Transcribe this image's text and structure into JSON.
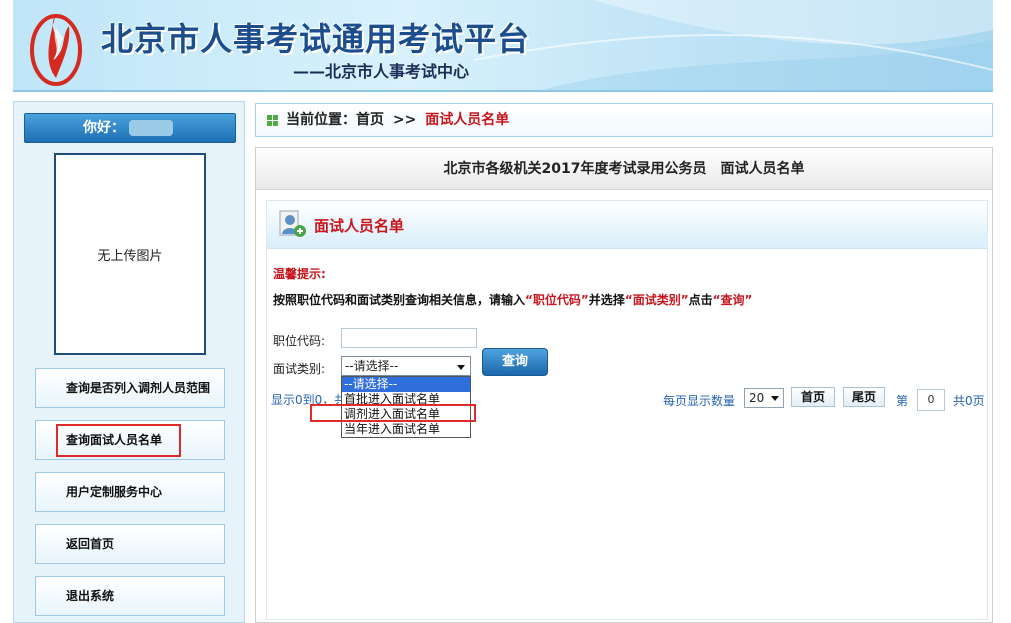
{
  "header": {
    "title": "北京市人事考试通用考试平台",
    "subtitle": "——北京市人事考试中心"
  },
  "sidebar": {
    "greeting": "你好：",
    "photo_text": "无上传图片",
    "items": [
      {
        "label": "查询是否列入调剂人员范围"
      },
      {
        "label": "查询面试人员名单"
      },
      {
        "label": "用户定制服务中心"
      },
      {
        "label": "返回首页"
      },
      {
        "label": "退出系统"
      }
    ]
  },
  "breadcrumb": {
    "prefix": "当前位置：首页",
    "sep": ">>",
    "current": "面试人员名单"
  },
  "main": {
    "heading": "北京市各级机关2017年度考试录用公务员　面试人员名单",
    "section_title": "面试人员名单",
    "tip_title": "温馨提示:",
    "tip_text": {
      "p1": "按照职位代码和面试类别查询相关信息，请输入",
      "k1": "“职位代码”",
      "p2": "并选择",
      "k2": "“面试类别”",
      "p3": "点击",
      "k3": "“查询”"
    },
    "form": {
      "position_code_label": "职位代码:",
      "position_code_value": "",
      "category_label": "面试类别:",
      "category_selected": "--请选择--",
      "category_options": [
        "--请选择--",
        "首批进入面试名单",
        "调剂进入面试名单",
        "当年进入面试名单"
      ],
      "query_label": "查询"
    },
    "results_info": "显示0到0，共",
    "pager": {
      "per_page_label": "每页显示数量",
      "per_page_value": "20",
      "first_label": "首页",
      "last_label": "尾页",
      "page_label": "第",
      "page_value": "0",
      "total_label": "共0页"
    }
  },
  "colors": {
    "accent_red": "#c8161d",
    "link_blue": "#2563b5",
    "button_blue": "#1c67ad",
    "highlight_box": "#e02b2b"
  }
}
